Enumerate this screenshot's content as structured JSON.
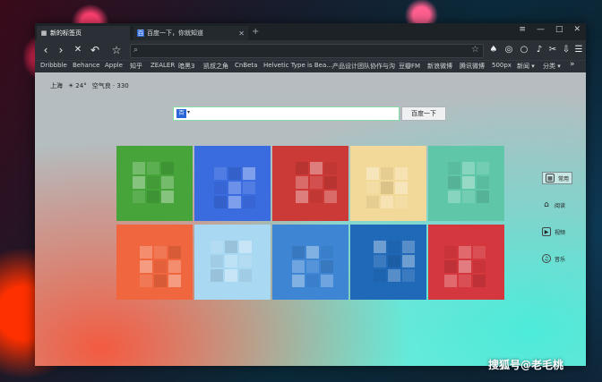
{
  "tabs": [
    {
      "label": "新的标签页",
      "active": true
    },
    {
      "label": "百度一下，你就知道",
      "active": false
    }
  ],
  "window_controls": [
    "≡",
    "—",
    "□",
    "✕"
  ],
  "toolbar": {
    "back": "‹",
    "forward": "›",
    "stop": "✕",
    "undo": "↶",
    "star": "☆",
    "address_value": "",
    "right_icons": [
      "♠",
      "◎",
      "○",
      "♪",
      "✂",
      "⇩",
      "▢",
      "☰"
    ]
  },
  "bookmarks": [
    "Dribbble",
    "Behance",
    "Apple",
    "知乎",
    "ZEALER",
    "暗黑3",
    "凯叔之角",
    "CnBeta",
    "Helvetic Type is Bea...",
    "产品设计团队协作与沟",
    "豆瓣FM",
    "新浪微博",
    "腾讯微博",
    "500px",
    "新闻 ▾",
    "分类 ▾"
  ],
  "weather": {
    "city": "上海",
    "icon": "☀",
    "temp": "24°",
    "air": "空气良 · 330"
  },
  "search": {
    "placeholder": "",
    "button": "百度一下"
  },
  "side_nav": [
    {
      "label": "常用",
      "icon": "▦",
      "selected": true
    },
    {
      "label": "阅读",
      "icon": "⌂",
      "selected": false
    },
    {
      "label": "视频",
      "icon": "▶",
      "selected": false
    },
    {
      "label": "音乐",
      "icon": "♫",
      "selected": false
    }
  ],
  "tiles": [
    {
      "color": "#46a43a"
    },
    {
      "color": "#3a6ce0"
    },
    {
      "color": "#cc3a37"
    },
    {
      "color": "#f3d999"
    },
    {
      "color": "#5fc7a8"
    },
    {
      "color": "#f0663e"
    },
    {
      "color": "#a9d8f2"
    },
    {
      "color": "#3e86d4"
    },
    {
      "color": "#1f69b8"
    },
    {
      "color": "#d4373d"
    }
  ],
  "watermark": "搜狐号@老毛桃"
}
